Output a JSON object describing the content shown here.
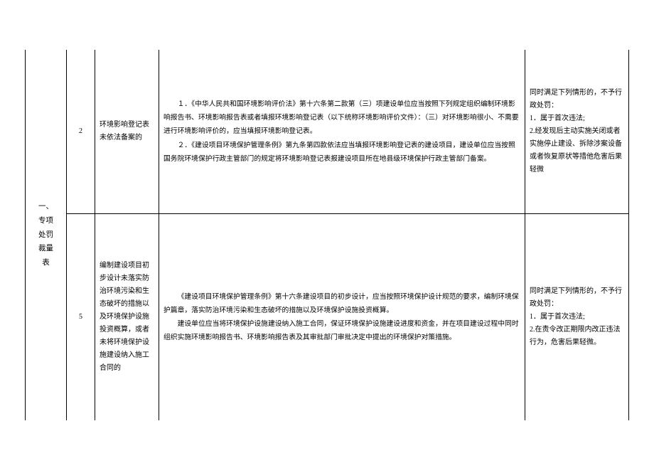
{
  "section_label": "一、专项处罚裁量表",
  "rows": [
    {
      "num": "2",
      "violation": "环境影响登记表未依法备案的",
      "body": [
        "１．《中华人民共和国环境影响评价法》第十六条第二款第（三）项建设单位应当按照下列规定组织编制环境影响报告书、环境影响报告表或者填报环境影响登记表（以下统称环境影响评价文件）：（三）对环境影响很小、不需要进行环境影响评价的，应当填报环境影响登记表。",
        "２．《建设项目环境保护管理条例》第九条第四款依法应当填报环境影响登记表的建设项目，建设单位应当按照国务院环境保护行政主管部门的规定将环境影响登记表报建设项目所在地县级环境保护行政主管部门备案。"
      ],
      "cond_header": "同时满足下列情形的，不予行政处罚：",
      "cond_items": [
        "1．属于首次违法;",
        "2.经发现后主动实施关闭或者实施停止建设、拆除涉案设备或者恢复原状等措他危害后果轻微"
      ]
    },
    {
      "num": "5",
      "violation": "编制建设项目初步设计未落实防治环境污染和生态破坏的措施以及环境保护设施投资概算，或者未将环境保护设施建设纳入施工合同的",
      "body": [
        "《建设项目环境保护管理条例》第十六条建设项目的初步设计，应当按照环境保护设计规范的要求，编制环境保护篇章，落实防治环境污染和生态破坏的措施以及环境保护设施投资概算。",
        "建设单位应当将环境保护设施建设纳入施工合同，保证环境保护设施建设进度和资金，并在项目建设过程中同时组织实施环境影响报告书、环境影响报告表及其审批部门审批决定中提出的环境保护对策措施。"
      ],
      "cond_header": "同时满足下列情形的，不予行政处罚：",
      "cond_items": [
        "1．属于首次违法;",
        "2.在责令改正期限内改正违法行为，危害后果轻微。"
      ]
    }
  ]
}
